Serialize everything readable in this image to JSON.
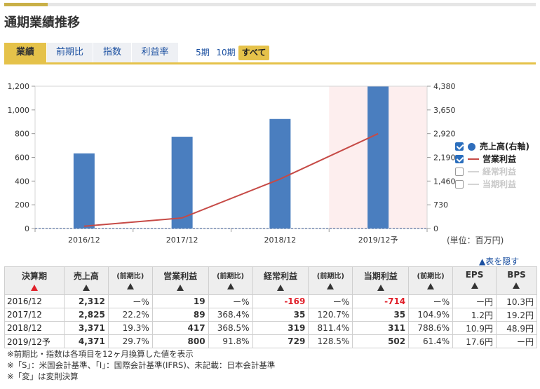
{
  "title": "通期業績推移",
  "tabs": [
    {
      "label": "業績",
      "active": true
    },
    {
      "label": "前期比",
      "active": false
    },
    {
      "label": "指数",
      "active": false
    },
    {
      "label": "利益率",
      "active": false
    }
  ],
  "periods": [
    {
      "label": "5期",
      "active": false
    },
    {
      "label": "10期",
      "active": false
    },
    {
      "label": "すべて",
      "active": true
    }
  ],
  "colors": {
    "bar": "#4a7ebf",
    "line": "#c64a46",
    "forecast_band": "#fdeeee",
    "accent": "#e5c24a",
    "negative": "#e0202a",
    "link": "#1a4fa0"
  },
  "legend": [
    {
      "label": "売上高(右軸)",
      "checked": true,
      "symbol": "dot",
      "color": "#2f6dbb"
    },
    {
      "label": "営業利益",
      "checked": true,
      "symbol": "line",
      "color": "#c64a46"
    },
    {
      "label": "経常利益",
      "checked": false,
      "symbol": "line",
      "color": "#d4d4d4"
    },
    {
      "label": "当期利益",
      "checked": false,
      "symbol": "line",
      "color": "#d4d4d4"
    }
  ],
  "unit_label": "(単位：百万円)",
  "hide_link": "▲表を隠す",
  "chart_data": {
    "type": "bar",
    "categories": [
      "2016/12",
      "2017/12",
      "2018/12",
      "2019/12予"
    ],
    "forecast_index": 3,
    "series": [
      {
        "name": "売上高(右軸)",
        "type": "bar",
        "axis": "right",
        "values": [
          2312,
          2825,
          3371,
          4371
        ]
      },
      {
        "name": "営業利益",
        "type": "line",
        "axis": "left",
        "values": [
          19,
          89,
          417,
          800
        ]
      }
    ],
    "y_left": {
      "ticks": [
        "0",
        "200",
        "400",
        "600",
        "800",
        "1,000",
        "1,200"
      ],
      "range": [
        0,
        1200
      ]
    },
    "y_right": {
      "ticks": [
        "0",
        "730",
        "1,460",
        "2,190",
        "2,920",
        "3,650",
        "4,380"
      ],
      "range": [
        0,
        4380
      ]
    },
    "grid": false
  },
  "table": {
    "headers": [
      {
        "label": "決算期",
        "arrow": "red"
      },
      {
        "label": "売上高",
        "arrow": "dark"
      },
      {
        "label": "(前期比)",
        "arrow": "dark",
        "sub": true
      },
      {
        "label": "営業利益",
        "arrow": "dark"
      },
      {
        "label": "(前期比)",
        "arrow": "dark",
        "sub": true
      },
      {
        "label": "経常利益",
        "arrow": "dark"
      },
      {
        "label": "(前期比)",
        "arrow": "dark",
        "sub": true
      },
      {
        "label": "当期利益",
        "arrow": "dark"
      },
      {
        "label": "(前期比)",
        "arrow": "dark",
        "sub": true
      },
      {
        "label": "EPS",
        "arrow": "dark"
      },
      {
        "label": "BPS",
        "arrow": "dark"
      }
    ],
    "rows": [
      [
        "2016/12",
        "2,312",
        "ー%",
        "19",
        "ー%",
        "-169",
        "ー%",
        "-714",
        "ー%",
        "ー円",
        "10.3円"
      ],
      [
        "2017/12",
        "2,825",
        "22.2%",
        "89",
        "368.4%",
        "35",
        "120.7%",
        "35",
        "104.9%",
        "1.2円",
        "19.2円"
      ],
      [
        "2018/12",
        "3,371",
        "19.3%",
        "417",
        "368.5%",
        "319",
        "811.4%",
        "311",
        "788.6%",
        "10.9円",
        "48.9円"
      ],
      [
        "2019/12予",
        "4,371",
        "29.7%",
        "800",
        "91.8%",
        "729",
        "128.5%",
        "502",
        "61.4%",
        "17.6円",
        "ー円"
      ]
    ]
  },
  "notes": [
    "※前期比・指数は各項目を12ヶ月換算した値を表示",
    "※「S」：米国会計基準、「I」：国際会計基準(IFRS)、未記載：日本会計基準",
    "※「変」は変則決算"
  ]
}
